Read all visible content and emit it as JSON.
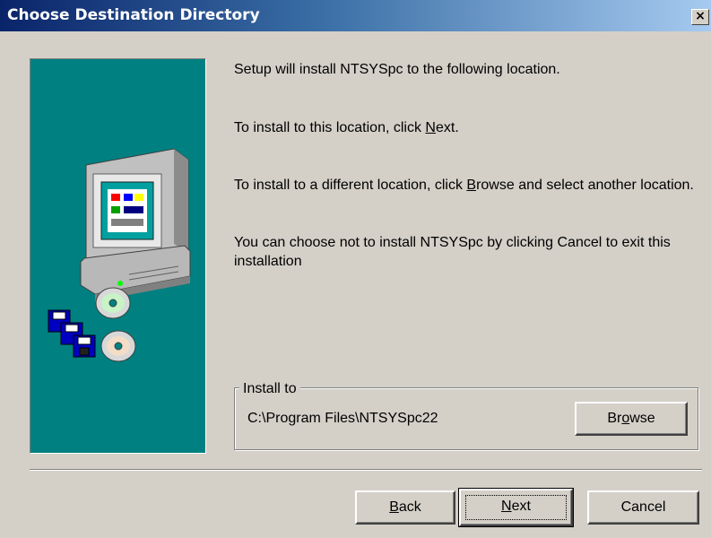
{
  "window": {
    "title": "Choose Destination Directory",
    "close_glyph": "×"
  },
  "messages": {
    "line1": "Setup will install NTSYSpc to the following location.",
    "line2_pre": "To install to this location, click ",
    "line2_key": "N",
    "line2_post": "ext.",
    "line3_pre": "To install to a different location, click ",
    "line3_key": "B",
    "line3_post": "rowse and select another location.",
    "line4": "You can choose not to install NTSYSpc by clicking Cancel to exit this installation"
  },
  "install_to": {
    "label": "Install to",
    "path": "C:\\Program Files\\NTSYSpc22",
    "browse_key": "o",
    "browse_pre": "Br",
    "browse_post": "wse"
  },
  "buttons": {
    "back_key": "B",
    "back_rest": "ack",
    "next_key": "N",
    "next_rest": "ext",
    "cancel": "Cancel"
  },
  "icons": {
    "illustration": "computer-monitor-icon",
    "disks": "floppy-disks-icon",
    "cds": "cd-discs-icon"
  },
  "colors": {
    "titlebar_start": "#0a246a",
    "titlebar_end": "#a6caf0",
    "panel": "#008080",
    "face": "#d4d0c8"
  }
}
